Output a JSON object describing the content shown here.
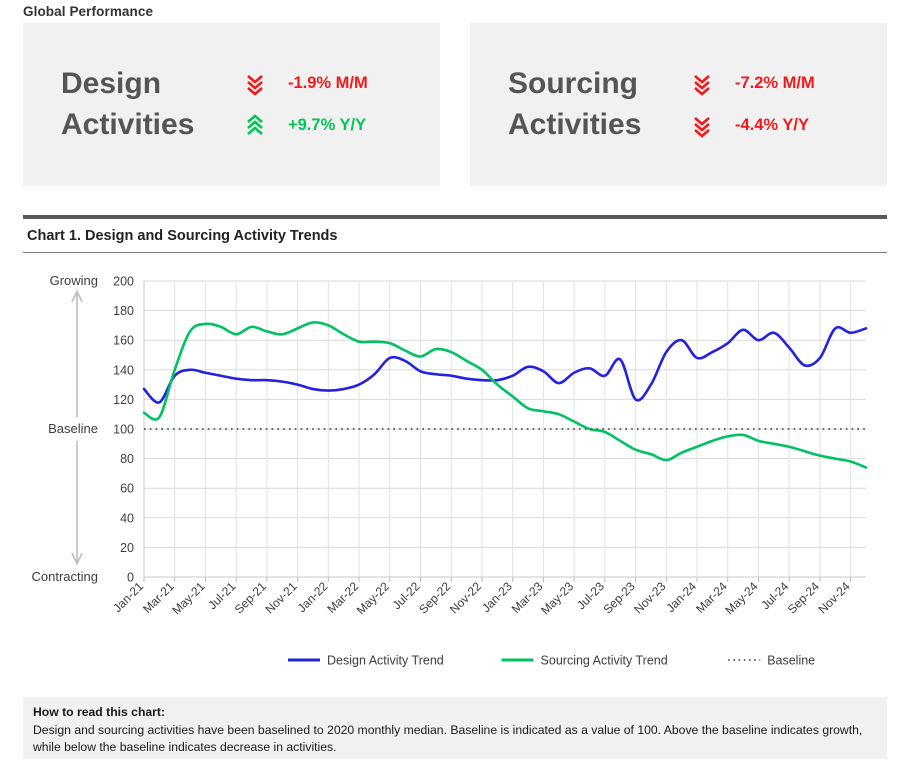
{
  "section": {
    "title": "Global Performance"
  },
  "kpis": [
    {
      "name": "design-activities",
      "label": "Design\nActivities",
      "metrics": [
        {
          "icon": "chevron-down-triple-icon",
          "direction": "down",
          "value": "-1.9% M/M",
          "tone": "negative"
        },
        {
          "icon": "chevron-up-triple-icon",
          "direction": "up",
          "value": "+9.7% Y/Y",
          "tone": "positive"
        }
      ]
    },
    {
      "name": "sourcing-activities",
      "label": "Sourcing\nActivities",
      "metrics": [
        {
          "icon": "chevron-down-triple-icon",
          "direction": "down",
          "value": "-7.2% M/M",
          "tone": "negative"
        },
        {
          "icon": "chevron-down-triple-icon",
          "direction": "down",
          "value": "-4.4% Y/Y",
          "tone": "negative"
        }
      ]
    }
  ],
  "chart_panel": {
    "title": "Chart 1. Design and Sourcing Activity Trends",
    "axis_annotations": {
      "top": "Growing",
      "middle": "Baseline",
      "bottom": "Contracting"
    }
  },
  "footnote": {
    "heading": "How to read this chart:",
    "body": "Design and sourcing activities have  been baselined to 2020 monthly median. Baseline is indicated as  a value of 100. Above the baseline indicates growth, while below the baseline indicates decrease in activities."
  },
  "colors": {
    "design": "#2222e0",
    "sourcing": "#00c261",
    "baseline": "#666666",
    "negative": "#ef1b1b",
    "positive": "#00c753",
    "card_bg": "#f1f1f1",
    "rule": "#595959"
  },
  "chart_data": {
    "type": "line",
    "title": "Chart 1. Design and Sourcing Activity Trends",
    "xlabel": "",
    "ylabel": "",
    "ylim": [
      0,
      200
    ],
    "yticks": [
      0,
      20,
      40,
      60,
      80,
      100,
      120,
      140,
      160,
      180,
      200
    ],
    "grid": true,
    "legend_position": "bottom",
    "annotations": [
      "Growing",
      "Baseline",
      "Contracting"
    ],
    "baseline_value": 100,
    "x": [
      "Jan-21",
      "Feb-21",
      "Mar-21",
      "Apr-21",
      "May-21",
      "Jun-21",
      "Jul-21",
      "Aug-21",
      "Sep-21",
      "Oct-21",
      "Nov-21",
      "Dec-21",
      "Jan-22",
      "Feb-22",
      "Mar-22",
      "Apr-22",
      "May-22",
      "Jun-22",
      "Jul-22",
      "Aug-22",
      "Sep-22",
      "Oct-22",
      "Nov-22",
      "Dec-22",
      "Jan-23",
      "Feb-23",
      "Mar-23",
      "Apr-23",
      "May-23",
      "Jun-23",
      "Jul-23",
      "Aug-23",
      "Sep-23",
      "Oct-23",
      "Nov-23",
      "Dec-23",
      "Jan-24",
      "Feb-24",
      "Mar-24",
      "Apr-24",
      "May-24",
      "Jun-24",
      "Jul-24",
      "Aug-24",
      "Sep-24",
      "Oct-24",
      "Nov-24",
      "Dec-24"
    ],
    "xtick_labels": [
      "Jan-21",
      "Mar-21",
      "May-21",
      "Jul-21",
      "Sep-21",
      "Nov-21",
      "Jan-22",
      "Mar-22",
      "May-22",
      "Jul-22",
      "Sep-22",
      "Nov-22",
      "Jan-23",
      "Mar-23",
      "May-23",
      "Jul-23",
      "Sep-23",
      "Nov-23",
      "Jan-24",
      "Mar-24",
      "May-24",
      "Jul-24",
      "Sep-24",
      "Nov-24"
    ],
    "series": [
      {
        "name": "Design Activity Trend",
        "color": "#2222e0",
        "style": "solid",
        "values": [
          127,
          118,
          136,
          140,
          138,
          136,
          134,
          133,
          133,
          132,
          130,
          127,
          126,
          127,
          130,
          137,
          148,
          146,
          139,
          137,
          136,
          134,
          133,
          133,
          136,
          142,
          139,
          131,
          138,
          141,
          136,
          147,
          120,
          130,
          152,
          160,
          148,
          152,
          158,
          167,
          160,
          165,
          155,
          143,
          148,
          168,
          165,
          168
        ]
      },
      {
        "name": "Sourcing Activity Trend",
        "color": "#00c261",
        "style": "solid",
        "values": [
          111,
          108,
          140,
          166,
          171,
          169,
          164,
          169,
          166,
          164,
          168,
          172,
          170,
          164,
          159,
          159,
          158,
          153,
          149,
          154,
          152,
          146,
          140,
          130,
          122,
          114,
          112,
          110,
          105,
          100,
          98,
          92,
          86,
          83,
          79,
          84,
          88,
          92,
          95,
          96,
          92,
          90,
          88,
          85,
          82,
          80,
          78,
          74
        ]
      },
      {
        "name": "Baseline",
        "color": "#666666",
        "style": "dotted",
        "values": [
          100,
          100,
          100,
          100,
          100,
          100,
          100,
          100,
          100,
          100,
          100,
          100,
          100,
          100,
          100,
          100,
          100,
          100,
          100,
          100,
          100,
          100,
          100,
          100,
          100,
          100,
          100,
          100,
          100,
          100,
          100,
          100,
          100,
          100,
          100,
          100,
          100,
          100,
          100,
          100,
          100,
          100,
          100,
          100,
          100,
          100,
          100,
          100
        ]
      }
    ]
  }
}
